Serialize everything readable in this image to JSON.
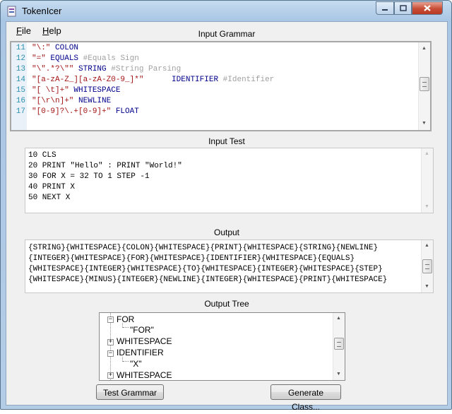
{
  "window": {
    "title": "TokenIcer"
  },
  "menu": [
    {
      "label": "File",
      "accel": "F",
      "rest": "ile"
    },
    {
      "label": "Help",
      "accel": "H",
      "rest": "elp"
    }
  ],
  "input_grammar": {
    "label": "Input Grammar",
    "lines": [
      {
        "num": "11",
        "parts": [
          {
            "t": "\"\\:\"",
            "c": "#a31515"
          },
          {
            "t": " COLON",
            "c": "#00008b"
          }
        ]
      },
      {
        "num": "12",
        "parts": [
          {
            "t": "\"=\"",
            "c": "#a31515"
          },
          {
            "t": " EQUALS",
            "c": "#00008b"
          },
          {
            "t": " #Equals Sign",
            "c": "#a0a0a0"
          }
        ]
      },
      {
        "num": "13",
        "parts": [
          {
            "t": "\"\\\".*?\\\"\"",
            "c": "#a31515"
          },
          {
            "t": " STRING",
            "c": "#00008b"
          },
          {
            "t": " #String Parsing",
            "c": "#a0a0a0"
          }
        ]
      },
      {
        "num": "14",
        "parts": [
          {
            "t": "\"[a-zA-Z_][a-zA-Z0-9_]*\"",
            "c": "#a31515"
          },
          {
            "t": "      IDENTIFIER",
            "c": "#00008b"
          },
          {
            "t": " #Identifier",
            "c": "#a0a0a0"
          }
        ]
      },
      {
        "num": "15",
        "parts": [
          {
            "t": "\"[ \\t]+\"",
            "c": "#a31515"
          },
          {
            "t": " WHITESPACE",
            "c": "#00008b"
          }
        ]
      },
      {
        "num": "16",
        "parts": [
          {
            "t": "\"[\\r\\n]+\"",
            "c": "#a31515"
          },
          {
            "t": " NEWLINE",
            "c": "#00008b"
          }
        ]
      },
      {
        "num": "17",
        "parts": [
          {
            "t": "\"[0-9]?\\.+[0-9]+\"",
            "c": "#a31515"
          },
          {
            "t": " FLOAT",
            "c": "#00008b"
          }
        ]
      }
    ]
  },
  "input_test": {
    "label": "Input Test",
    "lines": [
      "10 CLS",
      "20 PRINT \"Hello\" : PRINT \"World!\"",
      "30 FOR X = 32 TO 1 STEP -1",
      "40 PRINT X",
      "50 NEXT X"
    ]
  },
  "output": {
    "label": "Output",
    "lines": [
      "{STRING}{WHITESPACE}{COLON}{WHITESPACE}{PRINT}{WHITESPACE}{STRING}{NEWLINE}",
      "{INTEGER}{WHITESPACE}{FOR}{WHITESPACE}{IDENTIFIER}{WHITESPACE}{EQUALS}",
      "{WHITESPACE}{INTEGER}{WHITESPACE}{TO}{WHITESPACE}{INTEGER}{WHITESPACE}{STEP}",
      "{WHITESPACE}{MINUS}{INTEGER}{NEWLINE}{INTEGER}{WHITESPACE}{PRINT}{WHITESPACE}"
    ]
  },
  "output_tree": {
    "label": "Output Tree",
    "nodes": [
      {
        "text": "FOR",
        "expander": "−"
      },
      {
        "text": "\"FOR\"",
        "expander": ""
      },
      {
        "text": "WHITESPACE",
        "expander": "+"
      },
      {
        "text": "IDENTIFIER",
        "expander": "−"
      },
      {
        "text": "\"X\"",
        "expander": ""
      },
      {
        "text": "WHITESPACE",
        "expander": "+"
      }
    ]
  },
  "buttons": {
    "test_grammar": "Test Grammar",
    "generate_class": "Generate Class..."
  }
}
